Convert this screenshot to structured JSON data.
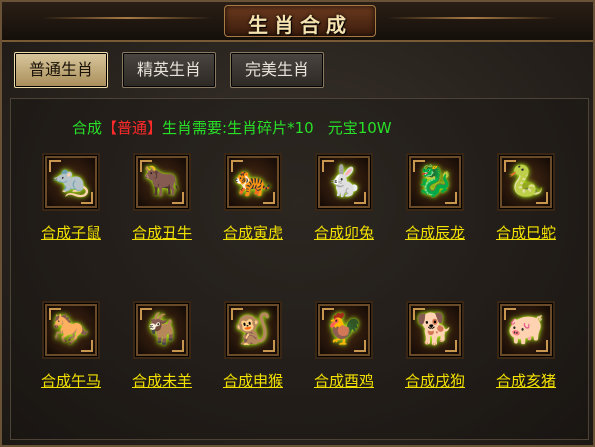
{
  "window": {
    "title": "生肖合成"
  },
  "tabs": [
    {
      "label": "普通生肖",
      "active": true
    },
    {
      "label": "精英生肖",
      "active": false
    },
    {
      "label": "完美生肖",
      "active": false
    }
  ],
  "requirement": {
    "prefix": "合成",
    "grade": "【普通】",
    "text": "生肖需要:生肖碎片*10",
    "cost": "元宝10W"
  },
  "colors": {
    "accent_green": "#28e028",
    "grade_red": "#ff2a2a",
    "link_yellow": "#f2e100"
  },
  "zodiacs": [
    {
      "label": "合成子鼠",
      "icon": "rat-icon",
      "glyph": "🐀"
    },
    {
      "label": "合成丑牛",
      "icon": "ox-icon",
      "glyph": "🐂"
    },
    {
      "label": "合成寅虎",
      "icon": "tiger-icon",
      "glyph": "🐅"
    },
    {
      "label": "合成卯兔",
      "icon": "rabbit-icon",
      "glyph": "🐇"
    },
    {
      "label": "合成辰龙",
      "icon": "dragon-icon",
      "glyph": "🐉"
    },
    {
      "label": "合成巳蛇",
      "icon": "snake-icon",
      "glyph": "🐍"
    },
    {
      "label": "合成午马",
      "icon": "horse-icon",
      "glyph": "🐎"
    },
    {
      "label": "合成未羊",
      "icon": "goat-icon",
      "glyph": "🐐"
    },
    {
      "label": "合成申猴",
      "icon": "monkey-icon",
      "glyph": "🐒"
    },
    {
      "label": "合成酉鸡",
      "icon": "rooster-icon",
      "glyph": "🐓"
    },
    {
      "label": "合成戌狗",
      "icon": "dog-icon",
      "glyph": "🐕"
    },
    {
      "label": "合成亥猪",
      "icon": "pig-icon",
      "glyph": "🐖"
    }
  ]
}
